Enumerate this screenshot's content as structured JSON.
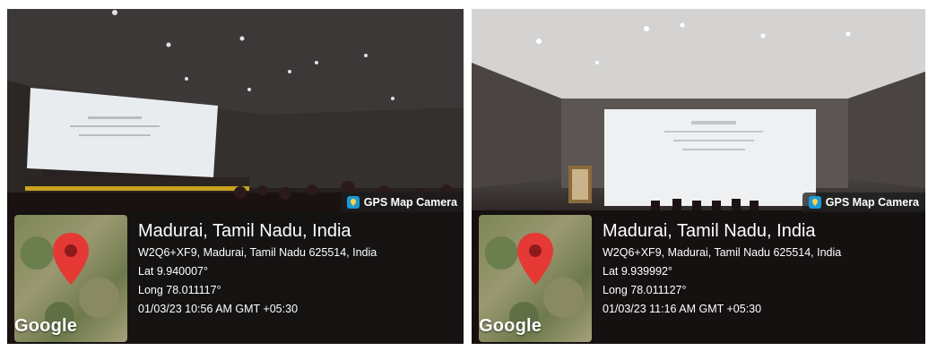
{
  "photos": [
    {
      "badge": "GPS Map Camera",
      "map_brand": "Google",
      "title": "Madurai, Tamil Nadu, India",
      "address": "W2Q6+XF9, Madurai, Tamil Nadu 625514, India",
      "lat": "Lat 9.940007°",
      "long": "Long 78.011117°",
      "datetime": "01/03/23 10:56 AM GMT +05:30"
    },
    {
      "badge": "GPS Map Camera",
      "map_brand": "Google",
      "title": "Madurai, Tamil Nadu, India",
      "address": "W2Q6+XF9, Madurai, Tamil Nadu 625514, India",
      "lat": "Lat 9.939992°",
      "long": "Long 78.011127°",
      "datetime": "01/03/23 11:16 AM GMT +05:30"
    }
  ],
  "colors": {
    "pin": "#e53935",
    "badge_logo": "#1a9bd7",
    "overlay": "rgba(20,20,20,0.62)"
  }
}
